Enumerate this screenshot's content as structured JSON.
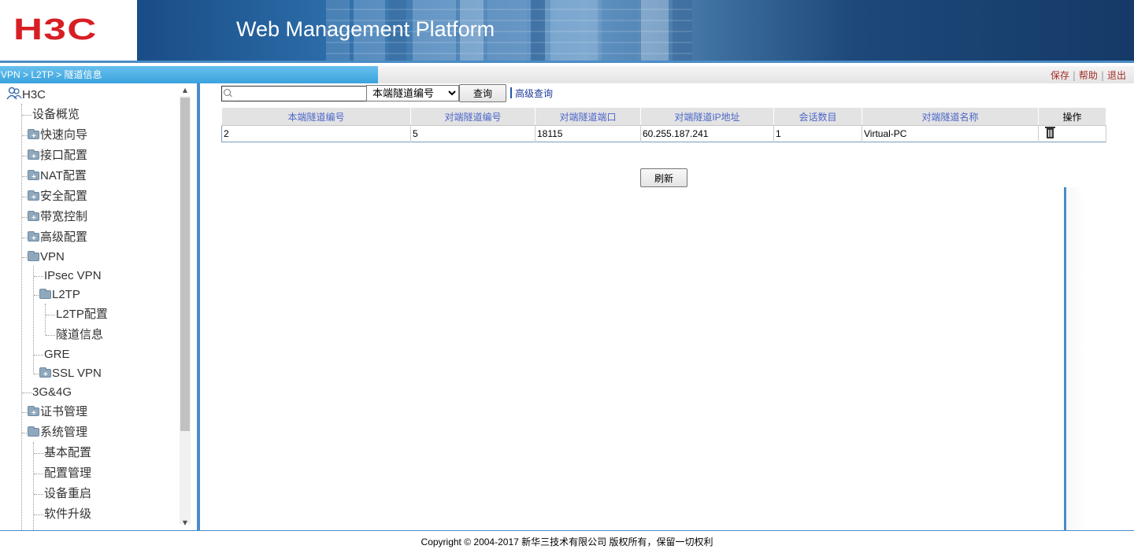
{
  "header": {
    "logo": "H3C",
    "title": "Web Management Platform"
  },
  "breadcrumb": "VPN > L2TP > 隧道信息",
  "top_links": {
    "save": "保存",
    "help": "帮助",
    "logout": "退出",
    "sep": "|"
  },
  "tree": {
    "root": "H3C",
    "items": [
      {
        "label": "设备概览"
      },
      {
        "label": "快速向导"
      },
      {
        "label": "接口配置"
      },
      {
        "label": "NAT配置"
      },
      {
        "label": "安全配置"
      },
      {
        "label": "带宽控制"
      },
      {
        "label": "高级配置"
      },
      {
        "label": "VPN"
      },
      {
        "label": "IPsec VPN"
      },
      {
        "label": "L2TP"
      },
      {
        "label": "L2TP配置"
      },
      {
        "label": "隧道信息"
      },
      {
        "label": "GRE"
      },
      {
        "label": "SSL VPN"
      },
      {
        "label": "3G&4G"
      },
      {
        "label": "证书管理"
      },
      {
        "label": "系统管理"
      },
      {
        "label": "基本配置"
      },
      {
        "label": "配置管理"
      },
      {
        "label": "设备重启"
      },
      {
        "label": "软件升级"
      }
    ]
  },
  "search": {
    "value": "",
    "selected_field": "本端隧道编号",
    "query_label": "查询",
    "advanced_label": "高级查询"
  },
  "table": {
    "headers": [
      "本端隧道编号",
      "对端隧道编号",
      "对端隧道端口",
      "对端隧道IP地址",
      "会话数目",
      "对端隧道名称",
      "操作"
    ],
    "rows": [
      [
        "2",
        "5",
        "18115",
        "60.255.187.241",
        "1",
        "Virtual-PC"
      ]
    ]
  },
  "refresh_label": "刷新",
  "footer": "Copyright © 2004-2017 新华三技术有限公司 版权所有，保留一切权利",
  "colors": {
    "accent": "#4a8cc7",
    "logo_red": "#d81e25",
    "header_link": "#4c66c9"
  }
}
